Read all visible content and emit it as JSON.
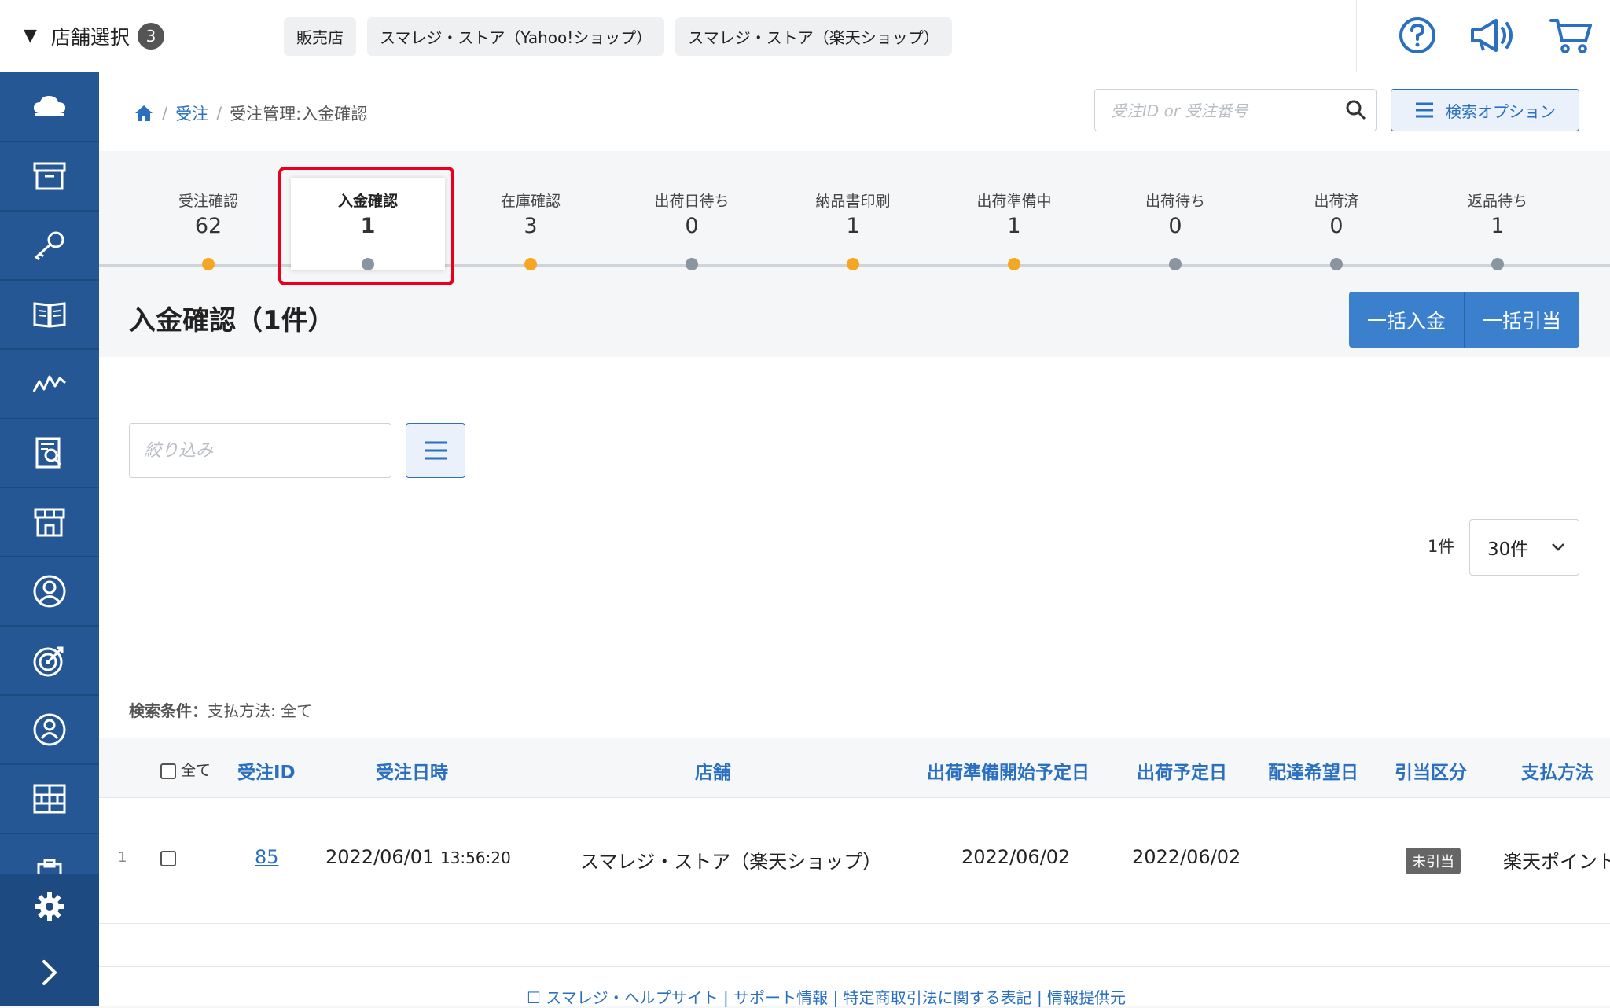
{
  "topbar": {
    "store_select_label": "店舗選択",
    "store_count": "3",
    "chips": [
      "販売店",
      "スマレジ・ストア（Yahoo!ショップ）",
      "スマレジ・ストア（楽天ショップ）"
    ],
    "icons": [
      "help-circle-icon",
      "megaphone-icon",
      "cart-icon"
    ]
  },
  "sidebar": {
    "items": [
      "cloud-icon",
      "archive-box-icon",
      "key-icon",
      "book-icon",
      "chart-line-icon",
      "report-search-icon",
      "store-icon",
      "user-circle-icon",
      "target-icon",
      "user-icon",
      "grid-icon",
      "clipboard-icon"
    ],
    "bottom": [
      "gear-icon",
      "chevron-right-icon"
    ]
  },
  "breadcrumb": {
    "home_icon": "home-icon",
    "link": "受注",
    "current": "受注管理:入金確認"
  },
  "search": {
    "placeholder": "受注ID or 受注番号",
    "options_label": "検索オプション"
  },
  "steps": [
    {
      "name": "受注確認",
      "count": "62",
      "dot": "orange"
    },
    {
      "name": "入金確認",
      "count": "1",
      "dot": "gray",
      "active": true
    },
    {
      "name": "在庫確認",
      "count": "3",
      "dot": "orange"
    },
    {
      "name": "出荷日待ち",
      "count": "0",
      "dot": "gray"
    },
    {
      "name": "納品書印刷",
      "count": "1",
      "dot": "orange"
    },
    {
      "name": "出荷準備中",
      "count": "1",
      "dot": "orange"
    },
    {
      "name": "出荷待ち",
      "count": "0",
      "dot": "gray"
    },
    {
      "name": "出荷済",
      "count": "0",
      "dot": "gray"
    },
    {
      "name": "返品待ち",
      "count": "1",
      "dot": "gray"
    }
  ],
  "page_title": "入金確認（1件）",
  "actions": {
    "bulk_payment": "一括入金",
    "bulk_allocate": "一括引当"
  },
  "filter": {
    "placeholder": "絞り込み"
  },
  "pagination": {
    "count_label": "1件",
    "per_page": "30件"
  },
  "conditions": {
    "label": "検索条件：",
    "value": "支払方法: 全て"
  },
  "table": {
    "select_all": "全て",
    "headers": [
      "受注ID",
      "受注日時",
      "店舗",
      "出荷準備開始予定日",
      "出荷予定日",
      "配達希望日",
      "引当区分",
      "支払方法"
    ],
    "rows": [
      {
        "index": "1",
        "id": "85",
        "date": "2022/06/01",
        "time": "13:56:20",
        "store": "スマレジ・ストア（楽天ショップ）",
        "prep_date": "2022/06/02",
        "ship_date": "2022/06/02",
        "delivery_date": "",
        "allocation": "未引当",
        "payment": "楽天ポイント"
      }
    ]
  },
  "footer": {
    "text": "スマレジ・ヘルプサイト | サポート情報 | 特定商取引法に関する表記 | 情報提供元"
  },
  "colors": {
    "sidebar": "#255795",
    "accent": "#2a6fc0",
    "button": "#3a80cc",
    "highlight": "#e8001c",
    "dot_orange": "#f5a623",
    "dot_gray": "#8a969f"
  }
}
